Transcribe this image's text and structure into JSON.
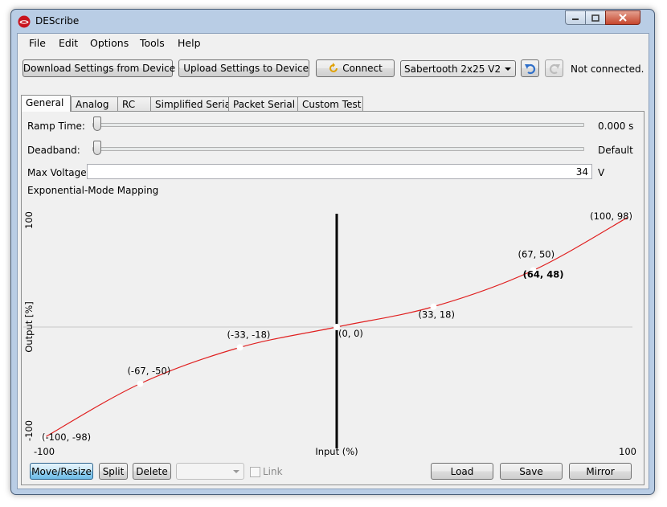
{
  "window": {
    "title": "DEScribe"
  },
  "menu": [
    "File",
    "Edit",
    "Options",
    "Tools",
    "Help"
  ],
  "toolbar": {
    "download_label": "Download Settings from Device",
    "upload_label": "Upload Settings to Device",
    "connect_label": "Connect",
    "device_selected": "Sabertooth 2x25 V2",
    "status": "Not connected."
  },
  "tabs": [
    "General",
    "Analog",
    "RC",
    "Simplified Serial",
    "Packet Serial",
    "Custom Test"
  ],
  "active_tab": "General",
  "general": {
    "ramp_time_label": "Ramp Time:",
    "ramp_time_value": "0.000 s",
    "ramp_time_slider": 0,
    "deadband_label": "Deadband:",
    "deadband_value": "Default",
    "deadband_slider": 0,
    "max_voltage_label": "Max Voltage:",
    "max_voltage_value": "34",
    "max_voltage_unit": "V",
    "mapping_label": "Exponential-Mode Mapping"
  },
  "chart_data": {
    "type": "line",
    "title": "",
    "xlabel": "Input (%)",
    "ylabel": "Output [%]",
    "xlim": [
      -100,
      100
    ],
    "ylim": [
      -100,
      100
    ],
    "x_ticks": [
      "-100",
      "100"
    ],
    "y_ticks": [
      "-100",
      "100"
    ],
    "line_color": "#e02020",
    "points": [
      {
        "x": -100,
        "y": -98,
        "label": "(-100, -98)"
      },
      {
        "x": -67,
        "y": -50,
        "label": "(-67, -50)"
      },
      {
        "x": -33,
        "y": -18,
        "label": "(-33, -18)"
      },
      {
        "x": 0,
        "y": 0,
        "label": "(0, 0)"
      },
      {
        "x": 33,
        "y": 18,
        "label": "(33, 18)"
      },
      {
        "x": 67,
        "y": 50,
        "label": "(67, 50)"
      },
      {
        "x": 100,
        "y": 98,
        "label": "(100, 98)"
      }
    ],
    "hover_point": {
      "x": 64,
      "y": 48,
      "label": "(64, 48)"
    }
  },
  "bottom": {
    "move_resize_label": "Move/Resize",
    "split_label": "Split",
    "delete_label": "Delete",
    "link_label": "Link",
    "load_label": "Load",
    "save_label": "Save",
    "mirror_label": "Mirror"
  }
}
